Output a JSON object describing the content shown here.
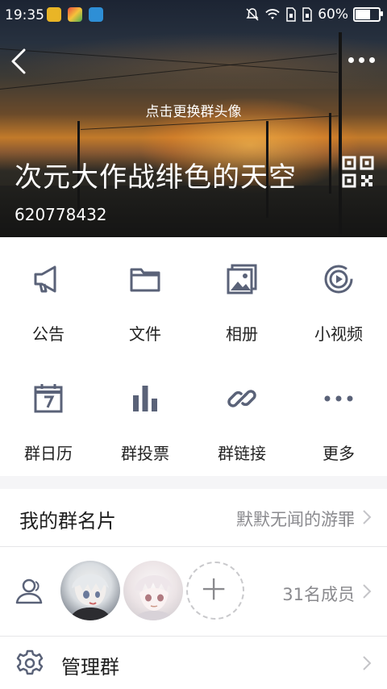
{
  "status_bar": {
    "time": "19:35",
    "battery": "60%",
    "battery_level": 0.6
  },
  "header": {
    "change_avatar_label": "点击更换群头像",
    "group_name": "次元大作战绯色的天空",
    "group_id": "620778432"
  },
  "tools": [
    {
      "label": "公告",
      "icon": "megaphone-icon"
    },
    {
      "label": "文件",
      "icon": "folder-icon"
    },
    {
      "label": "相册",
      "icon": "photo-album-icon"
    },
    {
      "label": "小视频",
      "icon": "video-play-icon"
    },
    {
      "label": "群日历",
      "icon": "calendar-icon"
    },
    {
      "label": "群投票",
      "icon": "bar-chart-icon"
    },
    {
      "label": "群链接",
      "icon": "link-icon"
    },
    {
      "label": "更多",
      "icon": "more-dots-icon"
    }
  ],
  "my_card": {
    "title": "我的群名片",
    "value": "默默无闻的游罪"
  },
  "members": {
    "count_label": "31名成员"
  },
  "manage": {
    "title": "管理群"
  },
  "colors": {
    "icon_gray": "#5a6278",
    "text_dark": "#222222",
    "text_secondary": "#8a8a8e",
    "background": "#f5f5f7"
  }
}
